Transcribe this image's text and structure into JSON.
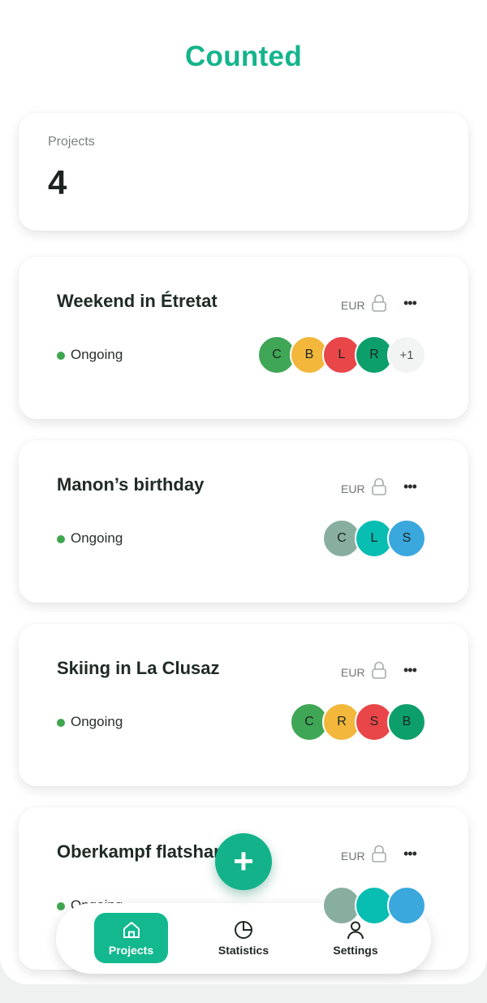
{
  "app": {
    "title": "Counted"
  },
  "summary": {
    "label": "Projects",
    "count": "4"
  },
  "projects": [
    {
      "name": "Weekend in Étretat",
      "currency": "EUR",
      "status": "Ongoing",
      "participants": [
        {
          "initial": "C",
          "color": "#3fa656"
        },
        {
          "initial": "B",
          "color": "#f2b73b"
        },
        {
          "initial": "L",
          "color": "#e9464a"
        },
        {
          "initial": "R",
          "color": "#0c9f6c"
        }
      ],
      "overflow": "+1"
    },
    {
      "name": "Manon’s birthday",
      "currency": "EUR",
      "status": "Ongoing",
      "participants": [
        {
          "initial": "C",
          "color": "#88ae9f"
        },
        {
          "initial": "L",
          "color": "#08bdb1"
        },
        {
          "initial": "S",
          "color": "#3aa7dd"
        }
      ]
    },
    {
      "name": "Skiing in La Clusaz",
      "currency": "EUR",
      "status": "Ongoing",
      "participants": [
        {
          "initial": "C",
          "color": "#3fa656"
        },
        {
          "initial": "R",
          "color": "#f2b73b"
        },
        {
          "initial": "S",
          "color": "#e9464a"
        },
        {
          "initial": "B",
          "color": "#0c9f6c"
        }
      ]
    },
    {
      "name": "Oberkampf flatshare",
      "currency": "EUR",
      "status": "Ongoing",
      "participants": [
        {
          "initial": "",
          "color": "#88ae9f"
        },
        {
          "initial": "",
          "color": "#08bdb1"
        },
        {
          "initial": "",
          "color": "#3aa7dd"
        }
      ]
    }
  ],
  "fab": {
    "label": "+"
  },
  "nav": {
    "items": [
      {
        "label": "Projects",
        "icon": "home-icon",
        "active": true
      },
      {
        "label": "Statistics",
        "icon": "pie-chart-icon",
        "active": false
      },
      {
        "label": "Settings",
        "icon": "user-icon",
        "active": false
      }
    ]
  },
  "colors": {
    "accent": "#14b48c",
    "status_ongoing": "#3fa64f"
  }
}
